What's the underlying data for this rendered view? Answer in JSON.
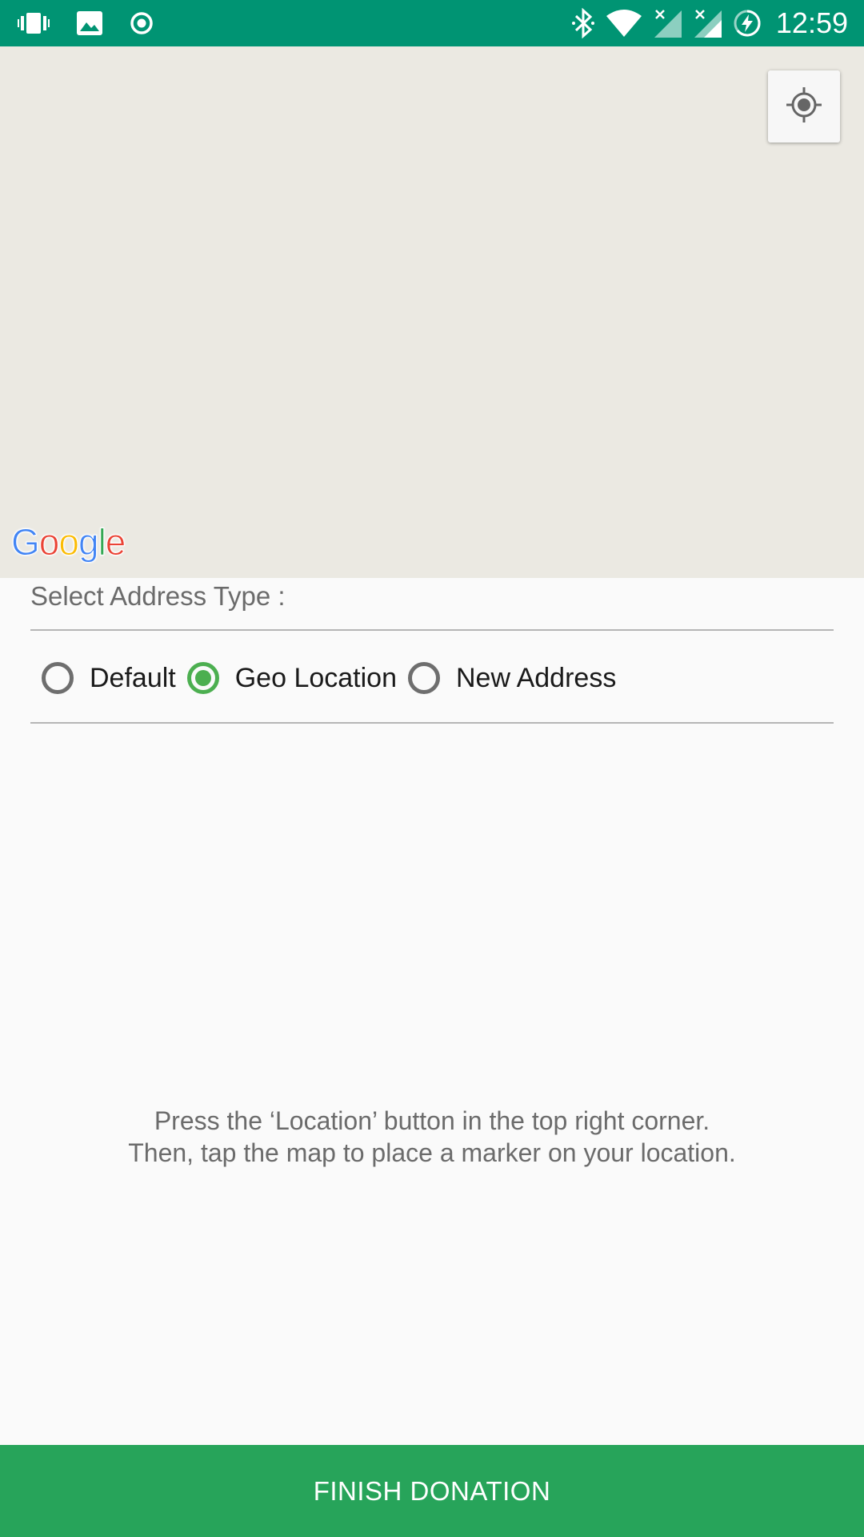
{
  "status_bar": {
    "time": "12:59",
    "left_icons": [
      "vibrate-icon",
      "image-icon",
      "record-icon"
    ],
    "right_icons": [
      "bluetooth-icon",
      "wifi-icon",
      "signal-no-sim-icon",
      "signal-no-sim-icon",
      "battery-charging-icon"
    ],
    "background": "#009473"
  },
  "map": {
    "logo_text": "Google",
    "locate_button_icon": "my-location-icon",
    "background": "#ebe9e2"
  },
  "address_section": {
    "title": "Select Address Type :",
    "options": [
      {
        "label": "Default",
        "checked": false
      },
      {
        "label": "Geo Location",
        "checked": true
      },
      {
        "label": "New Address",
        "checked": false
      }
    ],
    "accent": "#4caf50"
  },
  "instructions": {
    "line1": "Press the ‘Location’ button in the top right corner.",
    "line2": "Then, tap the map to place a marker on your location."
  },
  "finish_button": {
    "label": "FINISH DONATION",
    "color": "#27a45a"
  }
}
